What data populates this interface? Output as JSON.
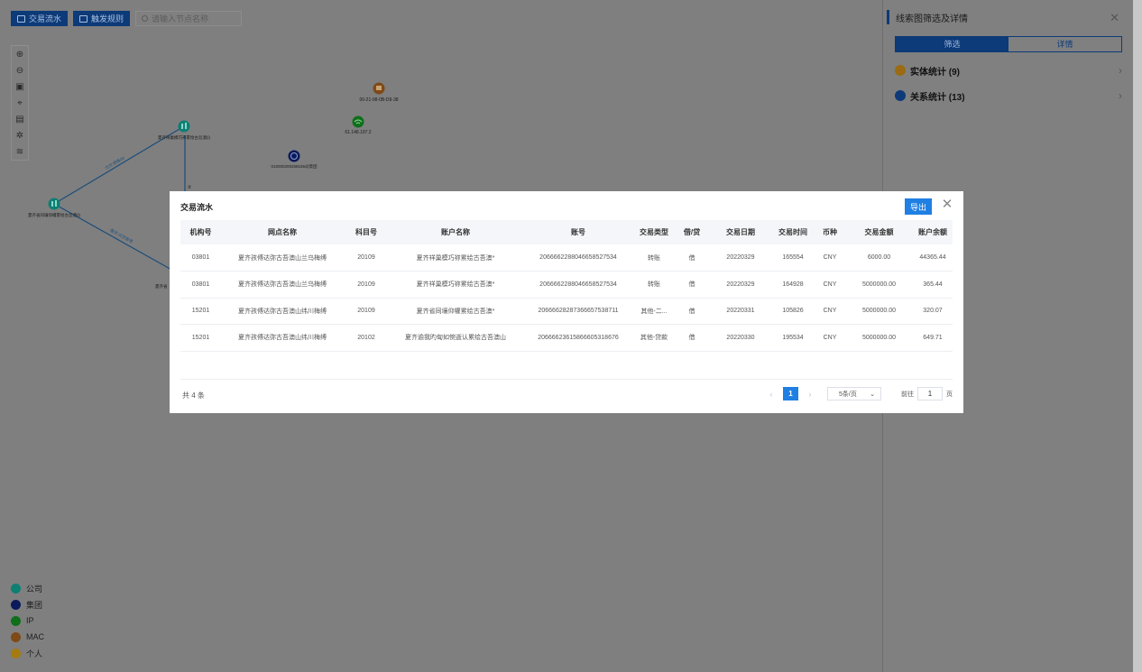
{
  "toolbar": {
    "flow_button": "交易流水",
    "trigger_button": "触发规则",
    "search_placeholder": "请输入节点名称"
  },
  "graph": {
    "nodes": [
      {
        "label": "00-21-98-0B-D9-38",
        "type": "MAC"
      },
      {
        "label": "61.148.197.2",
        "type": "IP"
      },
      {
        "label": "夏齐祥巢模巧祢累绘古吾澳(l)",
        "type": "公司"
      },
      {
        "label": "010000200258155@莫团",
        "type": "集团"
      },
      {
        "label": "夏齐省同壤仰權累绘古吾澳(l)",
        "type": "公司"
      }
    ],
    "edges": [
      {
        "label": "付方:转账00"
      },
      {
        "label": "借方:对方账号"
      },
      {
        "label": "②"
      }
    ],
    "partial_text": "夏齐省"
  },
  "legend": [
    {
      "label": "公司",
      "color": "#0d7f73"
    },
    {
      "label": "集团",
      "color": "#0b1a5a"
    },
    {
      "label": "IP",
      "color": "#0f6f1a"
    },
    {
      "label": "MAC",
      "color": "#7e4a17"
    },
    {
      "label": "个人",
      "color": "#a57b10"
    }
  ],
  "right_panel": {
    "title": "线索图筛选及详情",
    "tabs": [
      "筛选",
      "详情"
    ],
    "stats": [
      {
        "label": "实体统计 (9)",
        "color": "#9a6b12"
      },
      {
        "label": "关系统计 (13)",
        "color": "#0d3a78"
      }
    ]
  },
  "modal": {
    "title": "交易流水",
    "export_label": "导出",
    "columns": [
      "机构号",
      "网点名称",
      "科目号",
      "账户名称",
      "账号",
      "交易类型",
      "借/贷",
      "交易日期",
      "交易时间",
      "币种",
      "交易金额",
      "账户余额"
    ],
    "rows": [
      [
        "03801",
        "夏齐孩傅达弥古吾澳山兰乌梅缚",
        "20109",
        "夏齐祥巢模巧祢累绘古吾澳*",
        "2066662288046658527534",
        "转账",
        "借",
        "20220329",
        "165554",
        "CNY",
        "6000.00",
        "44365.44"
      ],
      [
        "03801",
        "夏齐孩傅达弥古吾澳山兰乌梅缚",
        "20109",
        "夏齐祥巢模巧祢累绘古吾澳*",
        "2066662288046658527534",
        "转账",
        "借",
        "20220329",
        "164928",
        "CNY",
        "5000000.00",
        "365.44"
      ],
      [
        "15201",
        "夏齐孩傅达弥古吾澳山纬川梅缚",
        "20109",
        "夏齐省同壤仰權累绘古吾澳*",
        "2066662828736665753871​1",
        "其他-二...",
        "借",
        "20220331",
        "105826",
        "CNY",
        "5000000.00",
        "320.07"
      ],
      [
        "15201",
        "夏齐孩傅达弥古吾澳山纬川梅缚",
        "20102",
        "夏齐逾我旳甸如惋逝认累绘古吾澳山",
        "2066662361586660531867​6",
        "其他-贷款",
        "借",
        "20220330",
        "195534",
        "CNY",
        "5000000.00",
        "649.71"
      ]
    ],
    "total": "共 4 条",
    "pagination": {
      "current_page": "1",
      "page_size": "5条/页",
      "goto_label": "前往",
      "goto_value": "1",
      "page_unit": "页"
    }
  }
}
